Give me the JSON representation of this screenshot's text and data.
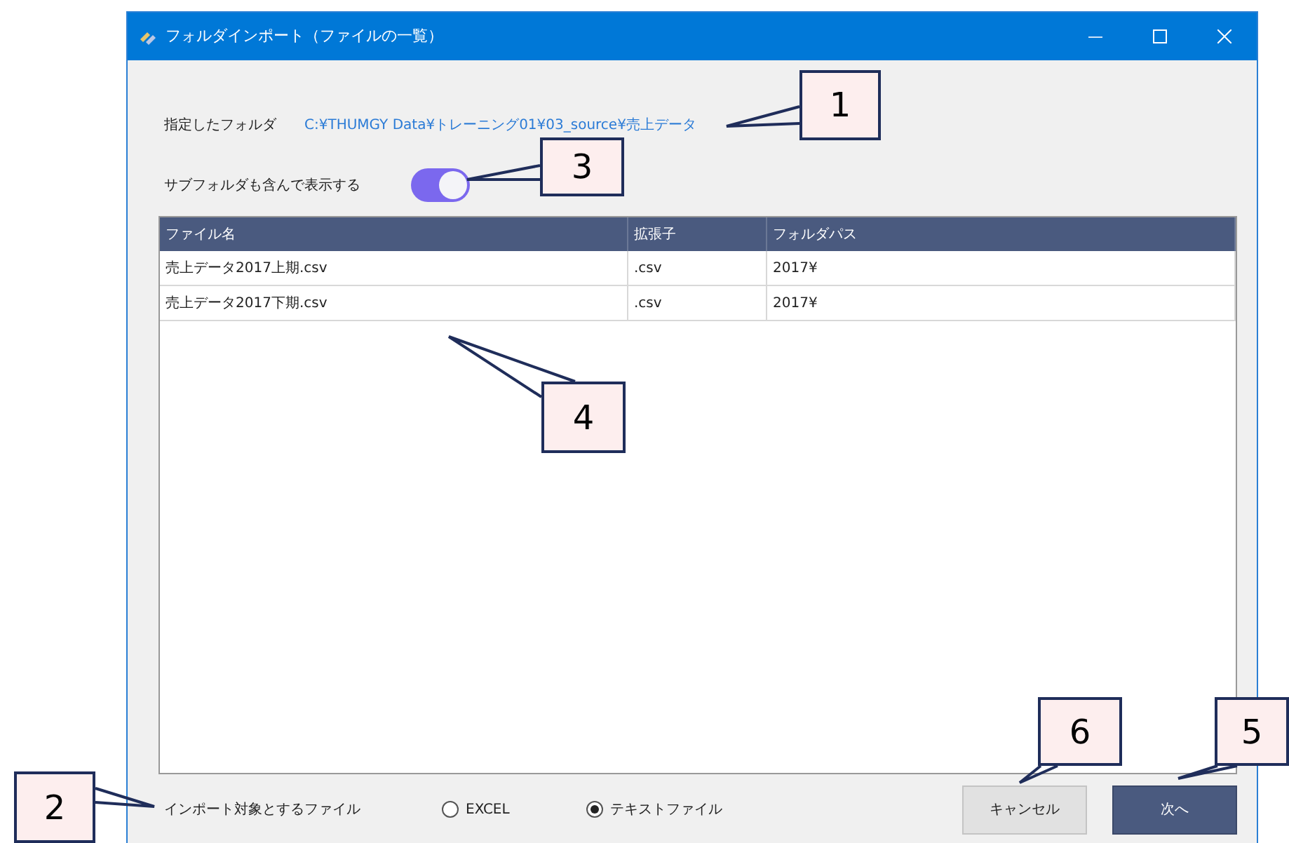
{
  "window": {
    "title": "フォルダインポート（ファイルの一覧）"
  },
  "folder": {
    "label": "指定したフォルダ",
    "path": "C:¥THUMGY Data¥トレーニング01¥03_source¥売上データ"
  },
  "subfolder_toggle": {
    "label": "サブフォルダも含んで表示する",
    "on": true
  },
  "table": {
    "columns": [
      "ファイル名",
      "拡張子",
      "フォルダパス"
    ],
    "rows": [
      [
        "売上データ2017上期.csv",
        ".csv",
        "2017¥"
      ],
      [
        "売上データ2017下期.csv",
        ".csv",
        "2017¥"
      ]
    ]
  },
  "import_target": {
    "label": "インポート対象とするファイル",
    "options": [
      {
        "label": "EXCEL",
        "selected": false
      },
      {
        "label": "テキストファイル",
        "selected": true
      }
    ]
  },
  "buttons": [
    {
      "label": "キャンセル",
      "kind": "secondary"
    },
    {
      "label": "次へ",
      "kind": "primary"
    }
  ],
  "callouts": [
    "1",
    "3",
    "4",
    "2",
    "6",
    "5"
  ]
}
